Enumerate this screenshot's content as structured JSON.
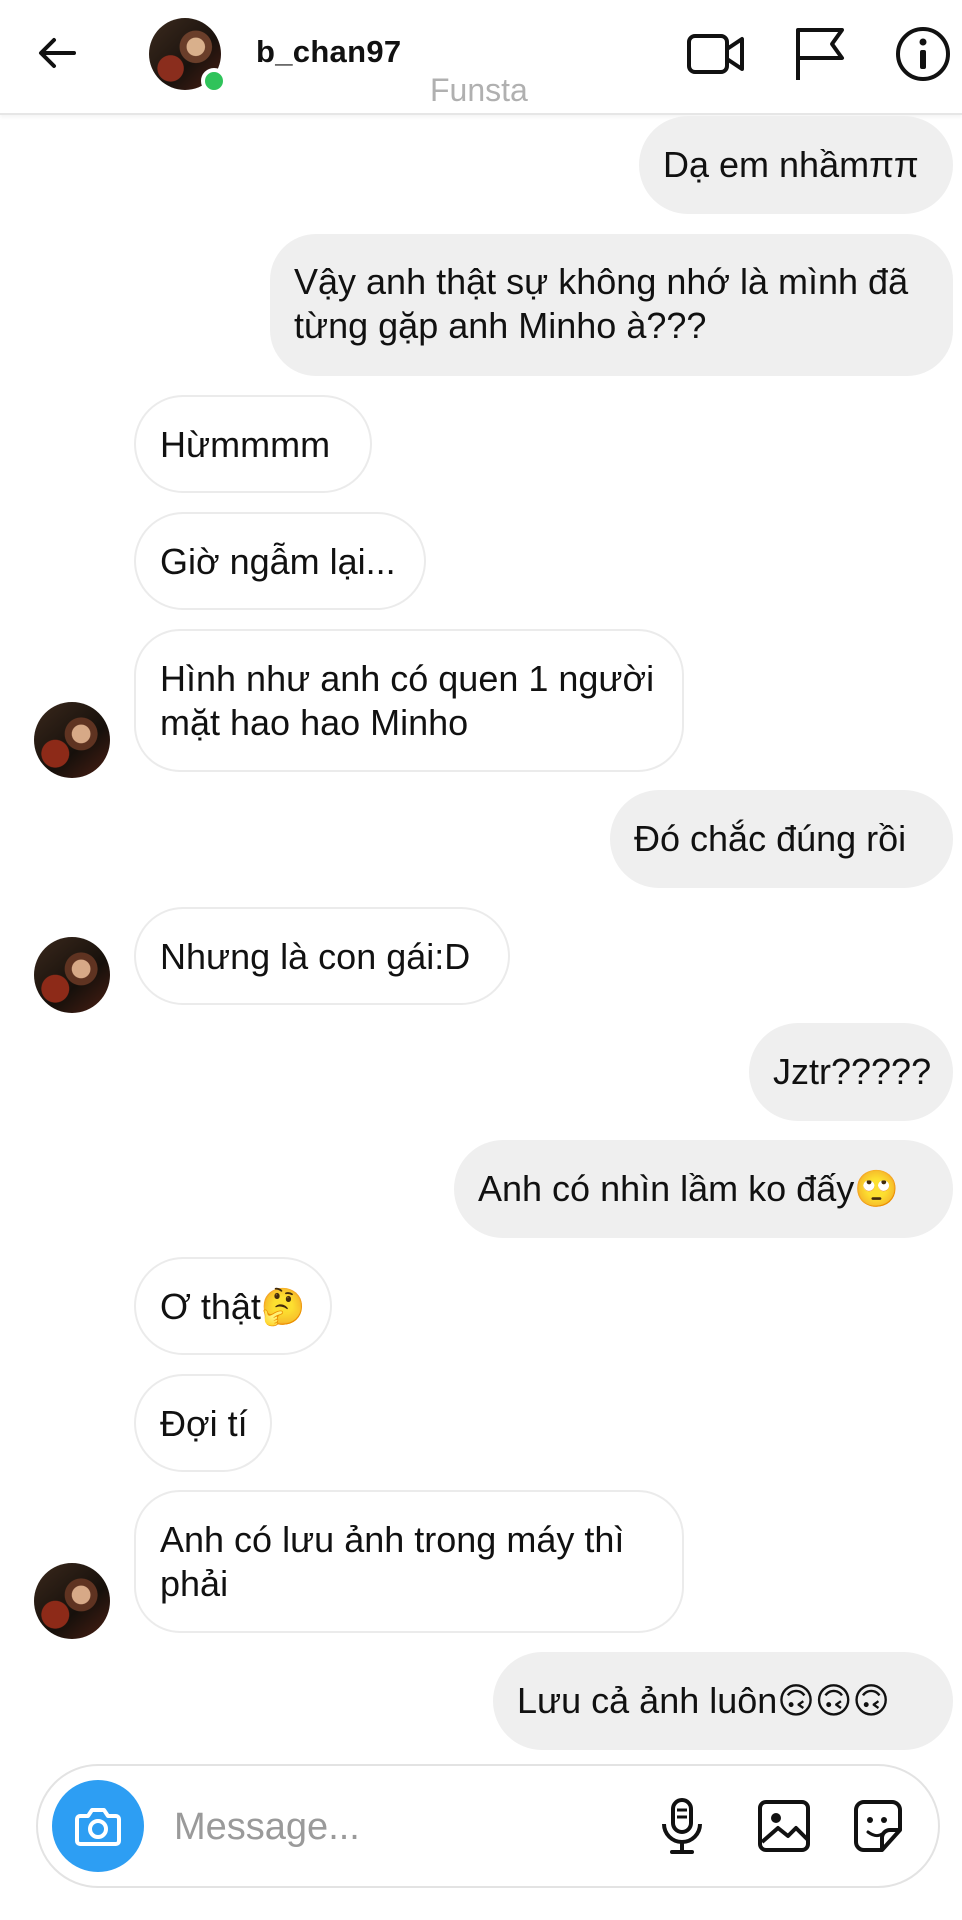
{
  "header": {
    "username": "b_chan97",
    "watermark": "Funsta"
  },
  "messages": [
    {
      "side": "sent",
      "text": "Dạ em nhầmππ"
    },
    {
      "side": "sent",
      "text": "Vậy anh thật sự không nhớ là mình đã từng gặp anh Minho à???"
    },
    {
      "side": "received",
      "text": "Hừmmmm"
    },
    {
      "side": "received",
      "text": "Giờ ngẫm lại..."
    },
    {
      "side": "received",
      "text": "Hình như anh có quen 1 người mặt hao hao Minho"
    },
    {
      "side": "sent",
      "text": "Đó chắc đúng rồi"
    },
    {
      "side": "received",
      "text": "Nhưng là con gái:D"
    },
    {
      "side": "sent",
      "text": "Jztr?????"
    },
    {
      "side": "sent",
      "text": "Anh có nhìn lầm ko đấy🙄"
    },
    {
      "side": "received",
      "text": "Ơ thật🤔"
    },
    {
      "side": "received",
      "text": "Đợi tí"
    },
    {
      "side": "received",
      "text": "Anh có lưu ảnh trong máy thì phải"
    },
    {
      "side": "sent",
      "text": "Lưu cả ảnh luôn🙃🙃🙃"
    }
  ],
  "composer": {
    "placeholder": "Message..."
  },
  "icons": {
    "header": [
      "back-arrow-icon",
      "video-call-icon",
      "flag-icon",
      "info-icon"
    ],
    "composer": [
      "camera-icon",
      "microphone-icon",
      "gallery-icon",
      "sticker-icon"
    ]
  },
  "colors": {
    "sent_bubble": "#efefef",
    "received_border": "#ebebeb",
    "camera_button": "#2d9ef3",
    "online_dot": "#2fc35a",
    "watermark": "#b0b0b0"
  }
}
